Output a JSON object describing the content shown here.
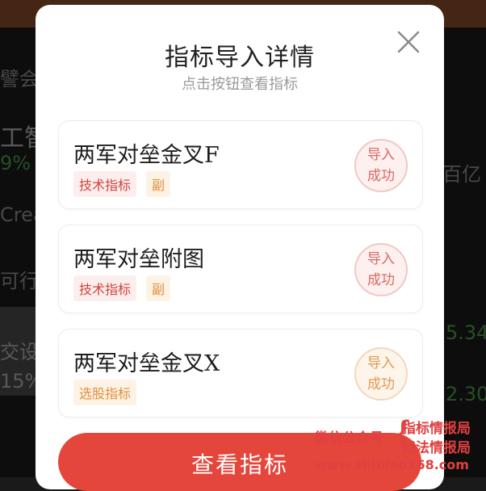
{
  "modal": {
    "title": "指标导入详情",
    "subtitle": "点击按钮查看指标",
    "close_icon": "close-icon"
  },
  "items": [
    {
      "name": "两军对垒金叉F",
      "tags": [
        "技术指标",
        "副"
      ],
      "status": [
        "导入",
        "成功"
      ],
      "accent": "#d0443c"
    },
    {
      "name": "两军对垒附图",
      "tags": [
        "技术指标",
        "副"
      ],
      "status": [
        "导入",
        "成功"
      ],
      "accent": "#d0443c"
    },
    {
      "name": "两军对垒金叉X",
      "tags": [
        "选股指标"
      ],
      "status": [
        "导入",
        "成功"
      ],
      "accent": "#e0903c"
    }
  ],
  "primary_button": {
    "label": "查看指标",
    "color": "#e4463c"
  },
  "watermark": {
    "line1": "微信公众号",
    "line2": "指标情报局",
    "line3": "战法情报局",
    "url": "www.zhibiao168.com"
  },
  "background": {
    "texts": [
      "譬会让",
      "工智",
      "9%",
      "Crea",
      "可行v",
      "交设",
      "15%",
      "百亿",
      "5.34",
      "2.30"
    ]
  }
}
